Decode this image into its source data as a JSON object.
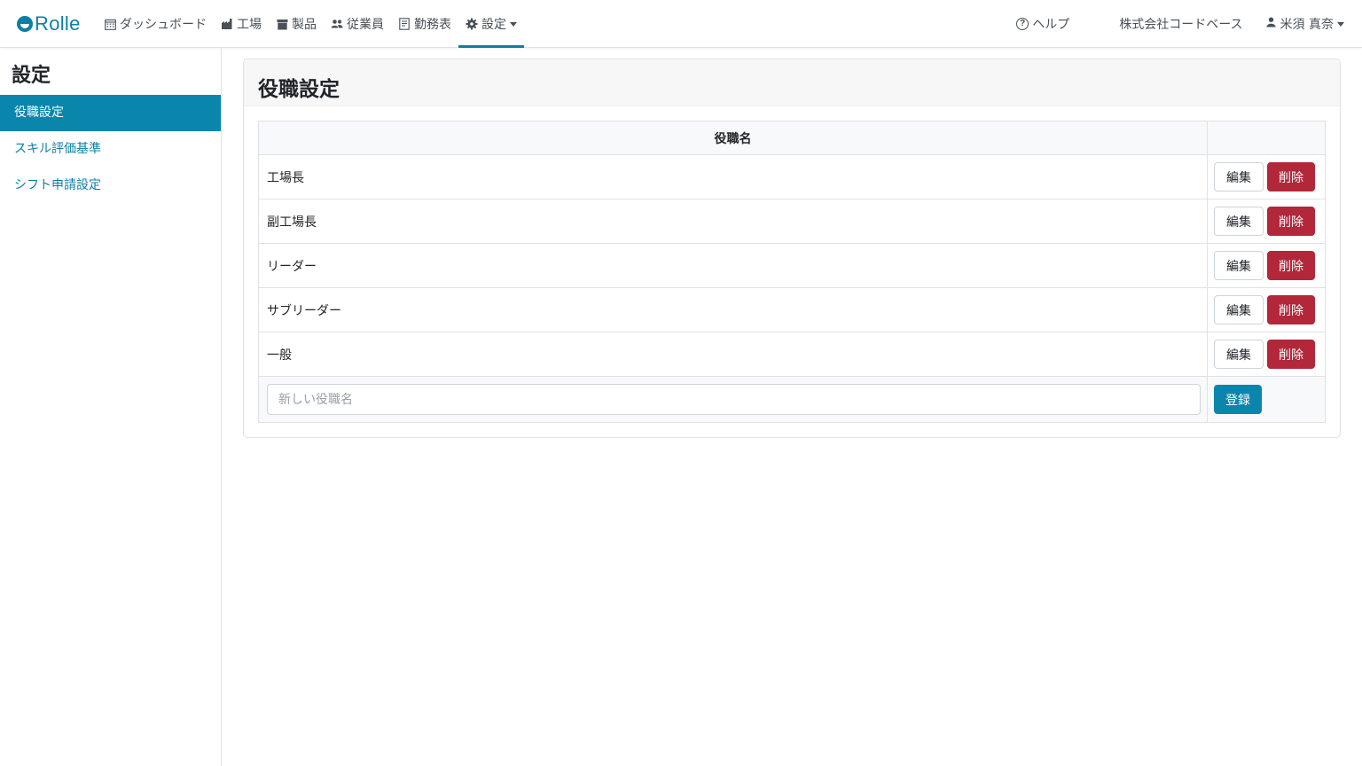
{
  "brand": {
    "name": "Rolle",
    "color": "#0c7fa4"
  },
  "nav": {
    "items": [
      {
        "label": "ダッシュボード",
        "icon": "calendar-icon"
      },
      {
        "label": "工場",
        "icon": "factory-icon"
      },
      {
        "label": "製品",
        "icon": "box-icon"
      },
      {
        "label": "従業員",
        "icon": "people-icon"
      },
      {
        "label": "勤務表",
        "icon": "document-icon"
      },
      {
        "label": "設定",
        "icon": "gear-icon",
        "active": true
      }
    ],
    "help": "ヘルプ",
    "company": "株式会社コードベース",
    "user": "米須 真奈"
  },
  "sidebar": {
    "title": "設定",
    "items": [
      {
        "label": "役職設定",
        "active": true
      },
      {
        "label": "スキル評価基準"
      },
      {
        "label": "シフト申請設定"
      }
    ]
  },
  "main": {
    "title": "役職設定",
    "table": {
      "header": "役職名",
      "rows": [
        {
          "name": "工場長"
        },
        {
          "name": "副工場長"
        },
        {
          "name": "リーダー"
        },
        {
          "name": "サブリーダー"
        },
        {
          "name": "一般"
        }
      ],
      "edit_label": "編集",
      "delete_label": "削除"
    },
    "new_role": {
      "placeholder": "新しい役職名",
      "value": "",
      "submit_label": "登録"
    }
  },
  "colors": {
    "accent": "#0a86ad",
    "danger": "#b3273a"
  }
}
